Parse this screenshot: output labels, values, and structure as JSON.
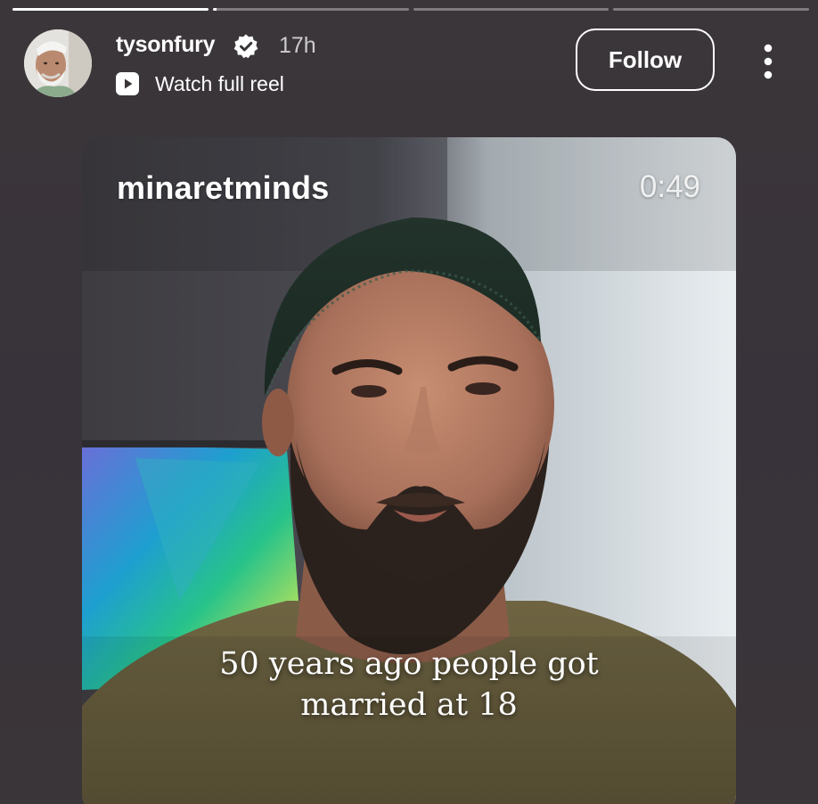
{
  "story": {
    "progress": [
      1,
      0.02,
      0,
      0
    ]
  },
  "header": {
    "username": "tysonfury",
    "time_ago": "17h",
    "watch_link": "Watch full reel",
    "follow_label": "Follow",
    "avatar_icon": "avatar-man-white-beard",
    "verified_icon": "verified-badge-icon",
    "more_icon": "more-vertical-icon"
  },
  "reel": {
    "author": "minaretminds",
    "duration": "0:49",
    "caption_line1": "50 years ago people got",
    "caption_line2": "married at 18"
  },
  "colors": {
    "background": "#3a3538",
    "accent": "#ffffff"
  }
}
